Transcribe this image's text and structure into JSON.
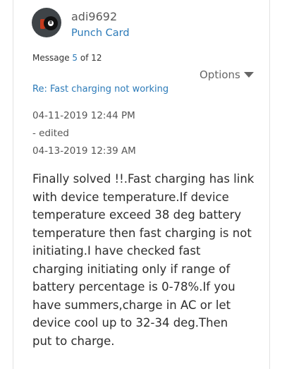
{
  "author": {
    "username": "adi9692",
    "rank": "Punch Card",
    "avatar_icon": "eight-ball-icon",
    "avatar_ball_number": "8"
  },
  "message_counter": {
    "prefix": "Message",
    "current": "5",
    "separator": "of",
    "total": "12"
  },
  "options": {
    "label": "Options"
  },
  "subject": "Re: Fast charging not working",
  "dates": {
    "posted": "04-11-2019 12:44 PM",
    "edited_label": "- edited",
    "edited": "04-13-2019 12:39 AM"
  },
  "body_lines": [
    "Finally solved !!.Fast charging has link",
    "with device temperature.If device",
    "temperature exceed 38 deg battery",
    "temperature then fast charging is not",
    "initiating.I have checked fast",
    "charging initiating only if range of",
    "battery percentage is 0-78%.If you",
    "have summers,charge in AC or let",
    "device cool up to 32-34 deg.Then",
    "put to charge."
  ],
  "colors": {
    "link": "#2b7ab8",
    "text": "#2d2d2d",
    "muted": "#555555"
  }
}
